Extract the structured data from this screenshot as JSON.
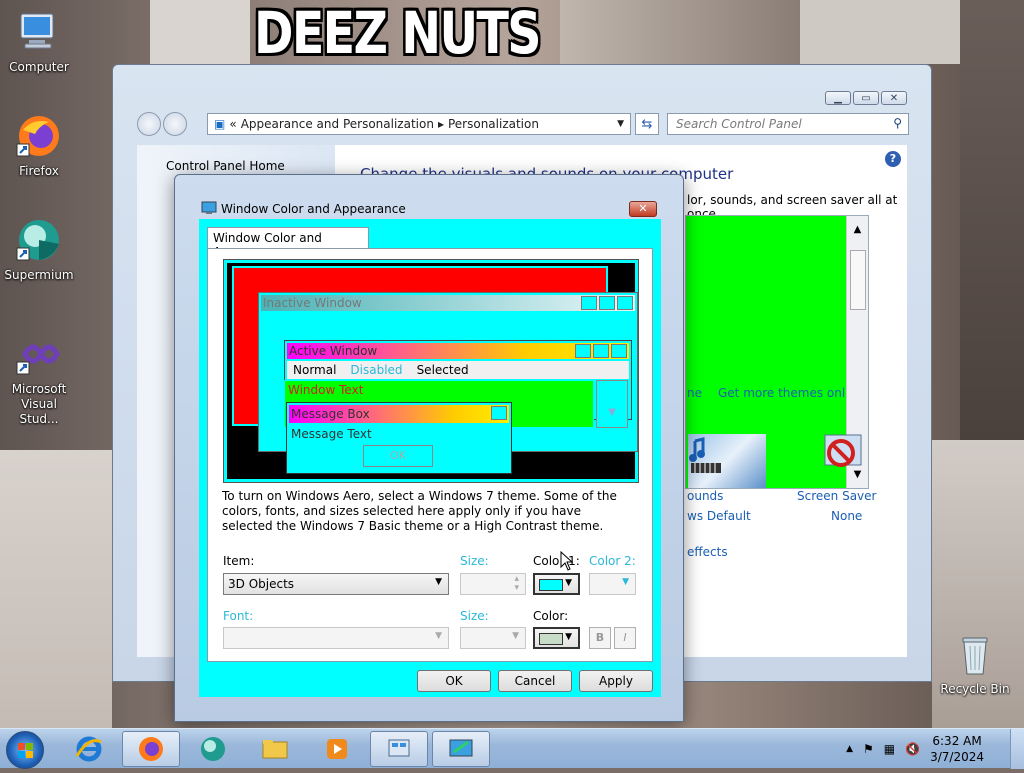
{
  "wallpaper": {
    "caption": "DEEZ NUTS"
  },
  "desktop_icons": [
    {
      "label": "Computer",
      "icon": "computer-icon"
    },
    {
      "label": "Firefox",
      "icon": "firefox-icon"
    },
    {
      "label": "Supermium",
      "icon": "supermium-icon"
    },
    {
      "label": "Microsoft Visual Stud...",
      "icon": "visual-studio-icon"
    },
    {
      "label": "Recycle Bin",
      "icon": "recycle-bin-icon"
    }
  ],
  "control_panel": {
    "breadcrumb": [
      "Appearance and Personalization",
      "Personalization"
    ],
    "search_placeholder": "Search Control Panel",
    "left_nav_home": "Control Panel Home",
    "heading": "Change the visuals and sounds on your computer",
    "subheading": "lor, sounds, and screen saver all at once.",
    "themes_link_partial": "ne",
    "get_more_themes": "Get more themes online",
    "sounds_label": "ounds",
    "sounds_value": "ws Default",
    "screen_saver_label": "Screen Saver",
    "screen_saver_value": "None",
    "effects_link": "effects"
  },
  "dialog": {
    "title": "Window Color and Appearance",
    "tab": "Window Color and Appearance",
    "preview": {
      "inactive_title": "Inactive Window",
      "active_title": "Active Window",
      "menu_normal": "Normal",
      "menu_disabled": "Disabled",
      "menu_selected": "Selected",
      "window_text": "Window Text",
      "message_box_title": "Message Box",
      "message_text": "Message Text",
      "ok": "OK"
    },
    "info_text": "To turn on Windows Aero, select a Windows 7 theme.  Some of the colors, fonts, and sizes selected here apply only if you have selected the Windows 7 Basic theme or a High Contrast theme.",
    "item_label": "Item:",
    "item_value": "3D Objects",
    "size_label": "Size:",
    "color1_label": "Color 1:",
    "color2_label": "Color 2:",
    "font_label": "Font:",
    "font_size_label": "Size:",
    "color_label": "Color:",
    "bold_label": "B",
    "italic_label": "I",
    "color1_value": "#00ffff",
    "color_value": "#c8dcc8",
    "buttons": {
      "ok": "OK",
      "cancel": "Cancel",
      "apply": "Apply"
    }
  },
  "taskbar": {
    "time": "6:32 AM",
    "date": "3/7/2024"
  }
}
